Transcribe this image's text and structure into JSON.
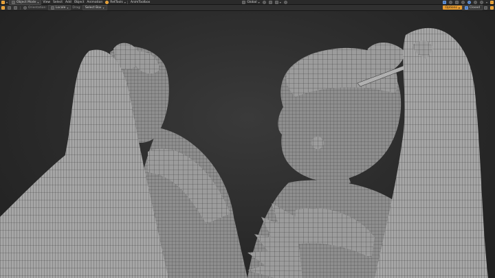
{
  "header": {
    "mode": "Object Mode",
    "menu": [
      "View",
      "Select",
      "Add",
      "Object",
      "Animation"
    ],
    "addons": [
      "RetTools",
      "AnimToolbox"
    ],
    "orientation": "Global",
    "right": [
      "Options",
      "Closed"
    ]
  },
  "toolbar": {
    "orientation_label": "Orientation:",
    "orientation_value": "Locale",
    "drag_label": "Drag:",
    "drag_value": "Select Box"
  },
  "colors": {
    "accent": "#e59a2f",
    "mesh_fill": "#9c9c9c",
    "wire": "#3c3c3c"
  }
}
